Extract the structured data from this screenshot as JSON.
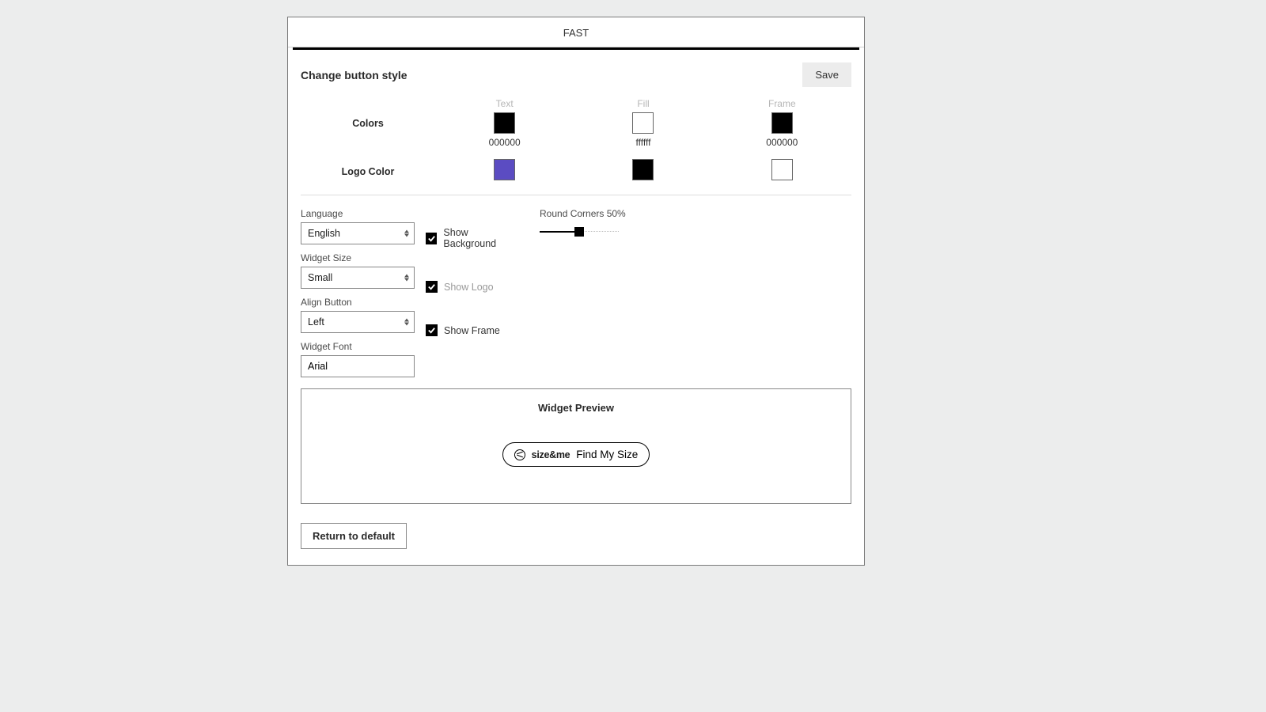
{
  "tab": {
    "label": "FAST"
  },
  "header": {
    "title": "Change button style",
    "save": "Save"
  },
  "colors": {
    "row_label": "Colors",
    "logo_row_label": "Logo Color",
    "text": {
      "label": "Text",
      "hex": "000000",
      "css": "#000000"
    },
    "fill": {
      "label": "Fill",
      "hex": "ffffff",
      "css": "#ffffff"
    },
    "frame": {
      "label": "Frame",
      "hex": "000000",
      "css": "#000000"
    },
    "logo1": {
      "css": "#5b4cc2"
    },
    "logo2": {
      "css": "#000000"
    },
    "logo3": {
      "css": "#ffffff"
    }
  },
  "form": {
    "language": {
      "label": "Language",
      "value": "English"
    },
    "widget_size": {
      "label": "Widget Size",
      "value": "Small"
    },
    "align": {
      "label": "Align Button",
      "value": "Left"
    },
    "font": {
      "label": "Widget Font",
      "value": "Arial"
    },
    "show_bg": {
      "label": "Show Background",
      "checked": true
    },
    "show_logo": {
      "label": "Show Logo",
      "checked": true
    },
    "show_frame": {
      "label": "Show Frame",
      "checked": true
    },
    "round": {
      "label": "Round Corners 50%",
      "percent": 50
    }
  },
  "preview": {
    "title": "Widget Preview",
    "logo_text": "size&me",
    "cta": "Find My Size"
  },
  "footer": {
    "return": "Return to default"
  }
}
